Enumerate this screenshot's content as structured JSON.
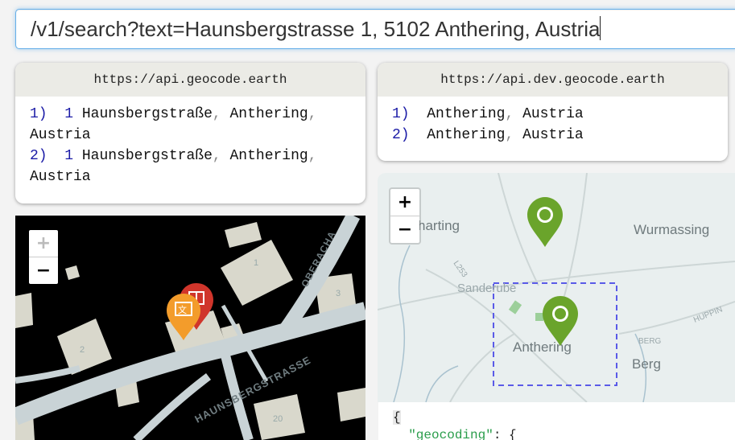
{
  "query": {
    "value": "/v1/search?text=Haunsbergstrasse 1, 5102 Anthering, Austria"
  },
  "left_panel": {
    "endpoint": "https://api.geocode.earth",
    "results": [
      {
        "index": "1)",
        "number": "1",
        "street": "Haunsbergstraße",
        "locality": "Anthering",
        "country": "Austria"
      },
      {
        "index": "2)",
        "number": "1",
        "street": "Haunsbergstraße",
        "locality": "Anthering",
        "country": "Austria"
      }
    ],
    "separator": ","
  },
  "right_panel": {
    "endpoint": "https://api.dev.geocode.earth",
    "results": [
      {
        "index": "1)",
        "locality": "Anthering",
        "country": "Austria"
      },
      {
        "index": "2)",
        "locality": "Anthering",
        "country": "Austria"
      }
    ],
    "separator": ","
  },
  "left_map": {
    "zoom_in": "+",
    "zoom_out": "−",
    "labels": {
      "street": "HAUNSBERGSTRASSE",
      "street2": "OBERACHA",
      "house1": "1",
      "house2": "2",
      "house3": "3",
      "house20": "20"
    },
    "colors": {
      "background": "#000000",
      "building": "#d9d8cc",
      "road": "#c9d3d6",
      "marker_front": "#f39c2b",
      "marker_back": "#d0352b"
    },
    "icons": [
      "translate-icon",
      "book-icon"
    ]
  },
  "right_map": {
    "zoom_in": "+",
    "zoom_out": "−",
    "labels": {
      "harting": "harting",
      "wurmassing": "Wurmassing",
      "sanderube": "Sanderube",
      "anthering": "Anthering",
      "berg_small": "BERG",
      "berg": "Berg",
      "road_l253": "L253",
      "hupping": "HUPPIN"
    },
    "colors": {
      "background": "#e9efef",
      "marker": "#6aa42b",
      "bbox": "#5a5ae8"
    },
    "icons": [
      "globe-icon"
    ]
  },
  "json_preview": {
    "line1": "{",
    "key": "\"geocoding\"",
    "after_key": ": {"
  }
}
